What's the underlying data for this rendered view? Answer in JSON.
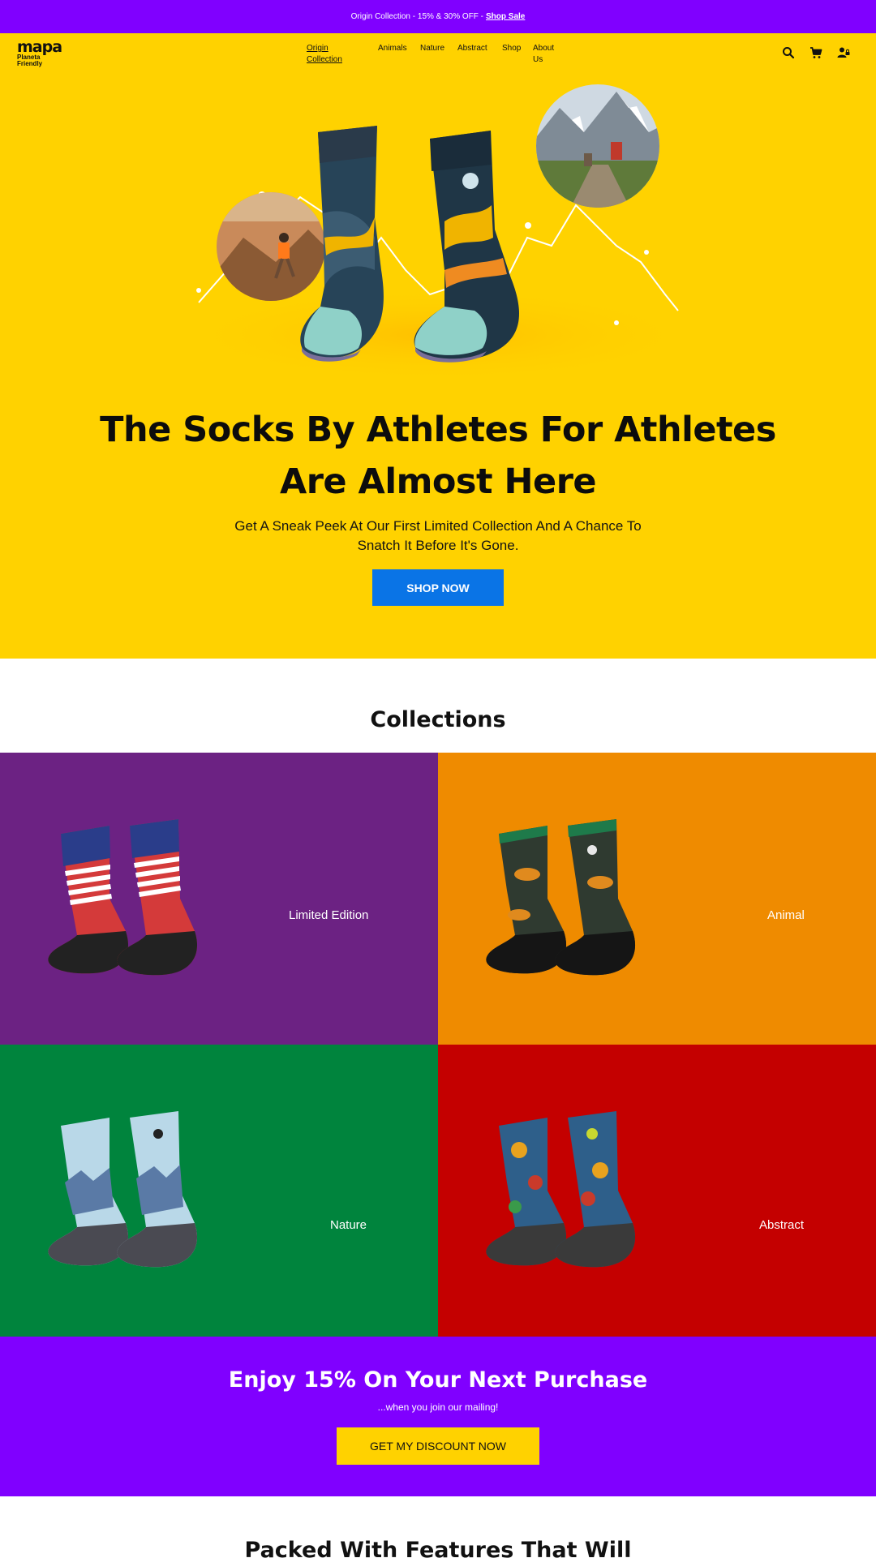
{
  "announcement": {
    "text": "Origin Collection - 15% & 30% OFF -",
    "link": "Shop Sale"
  },
  "logo": {
    "word": "mapa",
    "line1": "Planeta",
    "line2": "Friendly"
  },
  "nav": {
    "items": [
      {
        "line1": "Origin",
        "line2": "Collection"
      },
      {
        "line1": "Animals",
        "line2": ""
      },
      {
        "line1": "Nature",
        "line2": ""
      },
      {
        "line1": "Abstract",
        "line2": ""
      },
      {
        "line1": "Shop",
        "line2": ""
      },
      {
        "line1": "About",
        "line2": "Us"
      }
    ]
  },
  "header_icons": [
    "search-icon",
    "cart-icon",
    "account-icon"
  ],
  "hero": {
    "title_line1": "The Socks By Athletes For Athletes",
    "title_line2": "Are Almost Here",
    "subtitle_line1": "Get A Sneak Peek At Our First Limited Collection And A Chance To",
    "subtitle_line2": "Snatch It Before It's Gone.",
    "cta": "SHOP NOW"
  },
  "collections": {
    "heading": "Collections",
    "tiles": [
      {
        "label": "Limited Edition",
        "color": "#6c2283"
      },
      {
        "label": "Animal",
        "color": "#ef8b00"
      },
      {
        "label": "Nature",
        "color": "#00843d"
      },
      {
        "label": "Abstract",
        "color": "#c40000"
      }
    ]
  },
  "discount": {
    "title": "Enjoy 15% On Your Next Purchase",
    "subtitle": "...when you join our mailing!",
    "cta": "GET MY DISCOUNT NOW"
  },
  "features": {
    "heading": "Packed With Features That Will"
  },
  "colors": {
    "purple": "#8000ff",
    "yellow": "#ffd200",
    "blue": "#0a74e6"
  }
}
